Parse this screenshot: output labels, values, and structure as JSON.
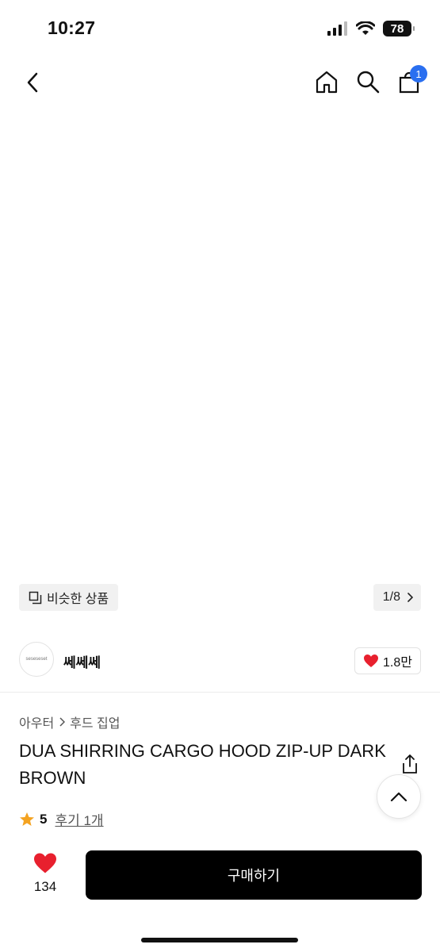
{
  "status_bar": {
    "time": "10:27",
    "battery": "78"
  },
  "nav": {
    "back_icon": "chevron-left-icon",
    "home_icon": "home-icon",
    "search_icon": "search-icon",
    "cart_icon": "shopping-bag-icon",
    "cart_badge": "1",
    "badge_color": "#2a6ff0"
  },
  "gallery": {
    "similar_label": "비슷한 상품",
    "page_indicator": "1/8"
  },
  "seller": {
    "name": "쎄쎄쎄",
    "avatar_text": "seseseset",
    "likes": "1.8만"
  },
  "product": {
    "breadcrumb": [
      "아우터",
      "후드 집업"
    ],
    "title": "DUA SHIRRING CARGO HOOD ZIP-UP DARK BROWN",
    "rating": "5",
    "review_label": "후기 1개"
  },
  "purchase_bar": {
    "wish_count": "134",
    "buy_label": "구매하기",
    "heart_color": "#e8202e"
  }
}
